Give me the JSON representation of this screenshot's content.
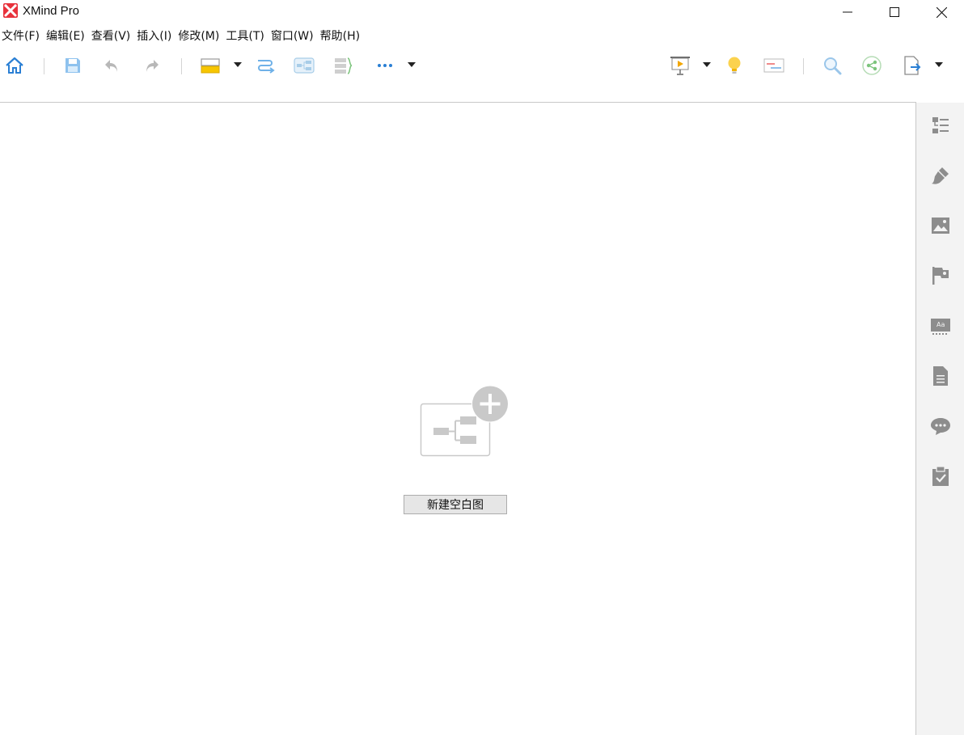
{
  "window": {
    "title": "XMind Pro",
    "logo_color": "#e8323c"
  },
  "menubar": {
    "items": [
      {
        "label": "文件(F)"
      },
      {
        "label": "编辑(E)"
      },
      {
        "label": "查看(V)"
      },
      {
        "label": "插入(I)"
      },
      {
        "label": "修改(M)"
      },
      {
        "label": "工具(T)"
      },
      {
        "label": "窗口(W)"
      },
      {
        "label": "帮助(H)"
      }
    ]
  },
  "toolbar": {
    "left_icons": [
      "home-icon",
      "save-icon",
      "undo-icon",
      "redo-icon",
      "topic-icon",
      "relationship-icon",
      "boundary-icon",
      "summary-icon",
      "more-icon"
    ],
    "right_icons": [
      "presentation-icon",
      "brainstorm-icon",
      "gantt-icon",
      "search-icon",
      "share-icon",
      "export-icon"
    ],
    "accent_color": "#2a7fd4"
  },
  "right_panel": {
    "icons": [
      "outline-icon",
      "format-icon",
      "image-icon",
      "marker-icon",
      "style-icon",
      "notes-icon",
      "comment-icon",
      "task-icon"
    ]
  },
  "main": {
    "new_blank_map_label": "新建空白图"
  }
}
